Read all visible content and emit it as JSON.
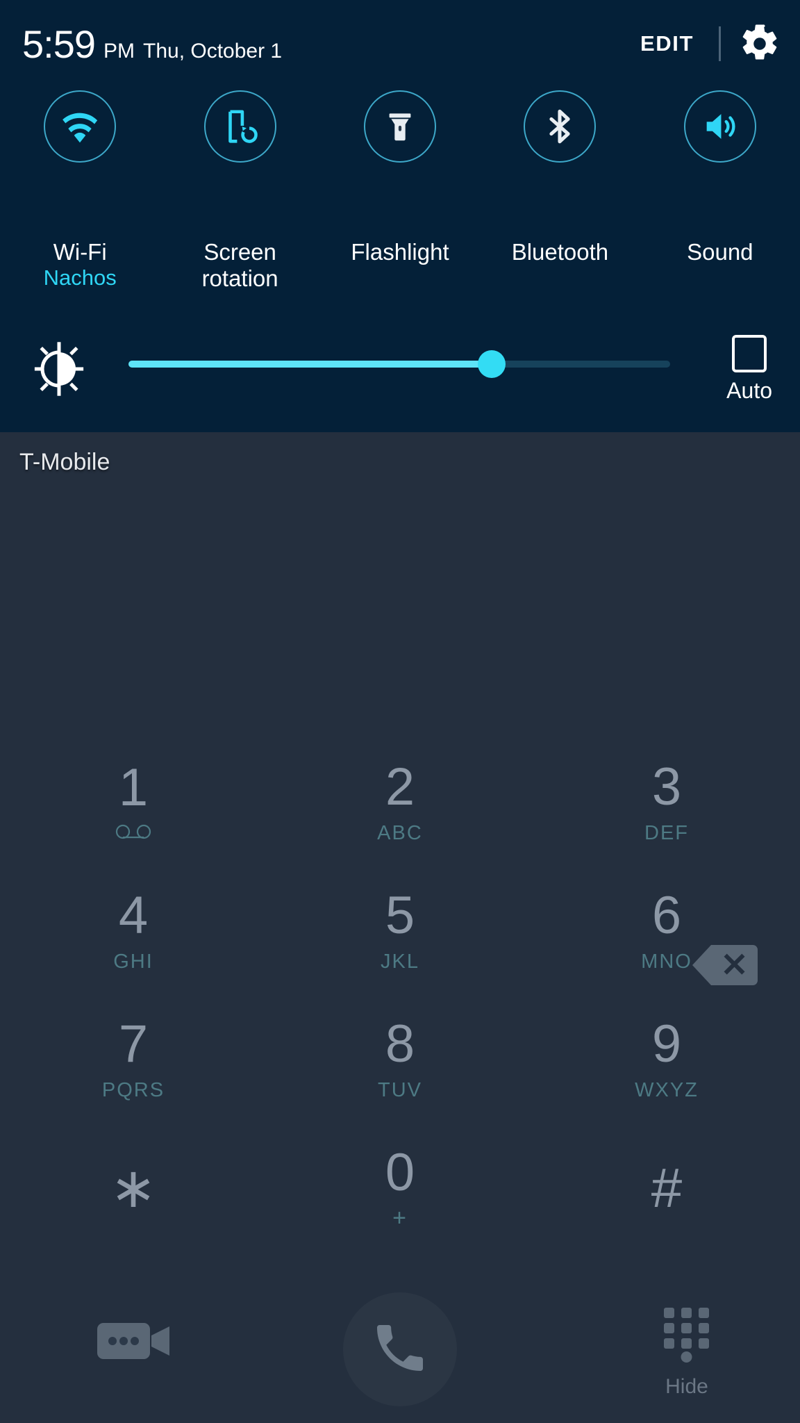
{
  "quick_settings": {
    "clock": {
      "time": "5:59",
      "ampm": "PM",
      "date": "Thu, October 1"
    },
    "edit_label": "EDIT",
    "settings_icon": "gear-icon",
    "toggles": [
      {
        "label": "Wi-Fi",
        "sublabel": "Nachos",
        "icon": "wifi-icon",
        "state": "on"
      },
      {
        "label": "Screen rotation",
        "sublabel": "",
        "icon": "screen-rotation-icon",
        "state": "on"
      },
      {
        "label": "Flashlight",
        "sublabel": "",
        "icon": "flashlight-icon",
        "state": "off"
      },
      {
        "label": "Bluetooth",
        "sublabel": "",
        "icon": "bluetooth-icon",
        "state": "off"
      },
      {
        "label": "Sound",
        "sublabel": "",
        "icon": "sound-icon",
        "state": "on"
      }
    ],
    "brightness": {
      "icon": "brightness-icon",
      "value_percent": 67,
      "auto_label": "Auto",
      "auto_checked": false
    },
    "colors": {
      "panel_bg": "#042038",
      "accent_cyan": "#2fd6f5",
      "accent_ring": "#3da8c9",
      "inactive_white": "#e9eef2"
    }
  },
  "dialer": {
    "carrier": "T-Mobile",
    "number_value": "",
    "backspace_icon": "backspace-icon",
    "keys": [
      {
        "digit": "1",
        "sub": "",
        "sub_icon": "voicemail-icon"
      },
      {
        "digit": "2",
        "sub": "ABC",
        "sub_icon": ""
      },
      {
        "digit": "3",
        "sub": "DEF",
        "sub_icon": ""
      },
      {
        "digit": "4",
        "sub": "GHI",
        "sub_icon": ""
      },
      {
        "digit": "5",
        "sub": "JKL",
        "sub_icon": ""
      },
      {
        "digit": "6",
        "sub": "MNO",
        "sub_icon": ""
      },
      {
        "digit": "7",
        "sub": "PQRS",
        "sub_icon": ""
      },
      {
        "digit": "8",
        "sub": "TUV",
        "sub_icon": ""
      },
      {
        "digit": "9",
        "sub": "WXYZ",
        "sub_icon": ""
      },
      {
        "digit": "∗",
        "sub": "",
        "sub_icon": ""
      },
      {
        "digit": "0",
        "sub": "+",
        "sub_icon": ""
      },
      {
        "digit": "#",
        "sub": "",
        "sub_icon": ""
      }
    ],
    "bottom_bar": {
      "video_call_icon": "video-call-icon",
      "call_icon": "phone-call-icon",
      "hide_icon": "keypad-icon",
      "hide_label": "Hide"
    },
    "colors": {
      "dialer_bg": "#242f3e",
      "digit_color": "#8d98a6",
      "sub_color": "#4d7a84",
      "carrier_color": "#e8eaed"
    }
  }
}
